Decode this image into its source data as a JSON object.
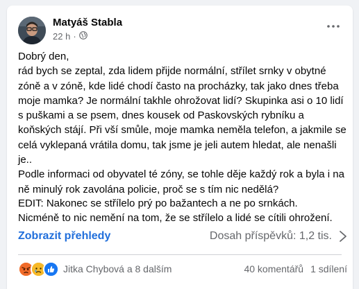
{
  "post": {
    "author": "Matyáš Stabla",
    "time": "22 h",
    "separator": "·",
    "privacy_icon": "globe-icon",
    "paragraphs": [
      "Dobrý den,\nrád bych se zeptal, zda lidem přijde normální, střílet srnky v obytné zóně a v zóně, kde lidé chodí často na procházky, tak jako dnes třeba moje mamka? Je normální takhle ohrožovat lidí? Skupinka asi o 10 lidí s puškami a se psem, dnes kousek od Paskovských rybníku a koňských stájí. Při vší smůle, moje mamka neměla telefon, a jakmile se celá vyklepaná vrátila domu, tak jsme je jeli autem hledat, ale nenašli je..",
      "Podle informaci od obyvatel té zóny, se tohle děje každý rok a byla i na ně minulý rok zavolána policie, proč se s tím nic nedělá?"
    ],
    "edit": "EDIT: Nakonec se střílelo prý po bažantech a ne po srnkách.\nNicméně to nic nemění na tom, že se střílelo a lidé se cítili ohrožení."
  },
  "insights": {
    "link_label": "Zobrazit přehledy",
    "reach_label": "Dosah příspěvků: 1,2 tis.",
    "chevron_icon": "chevron-right-icon"
  },
  "footer": {
    "reaction_icons": [
      "angry-icon",
      "sad-icon",
      "like-icon"
    ],
    "reacted_by": "Jitka Chybová a 8 dalším",
    "comments": "40 komentářů",
    "shares": "1 sdílení"
  },
  "colors": {
    "link": "#216fdb",
    "muted": "#65676b",
    "angry": "#e9710f",
    "sad": "#f7b125",
    "like": "#1877f2"
  }
}
